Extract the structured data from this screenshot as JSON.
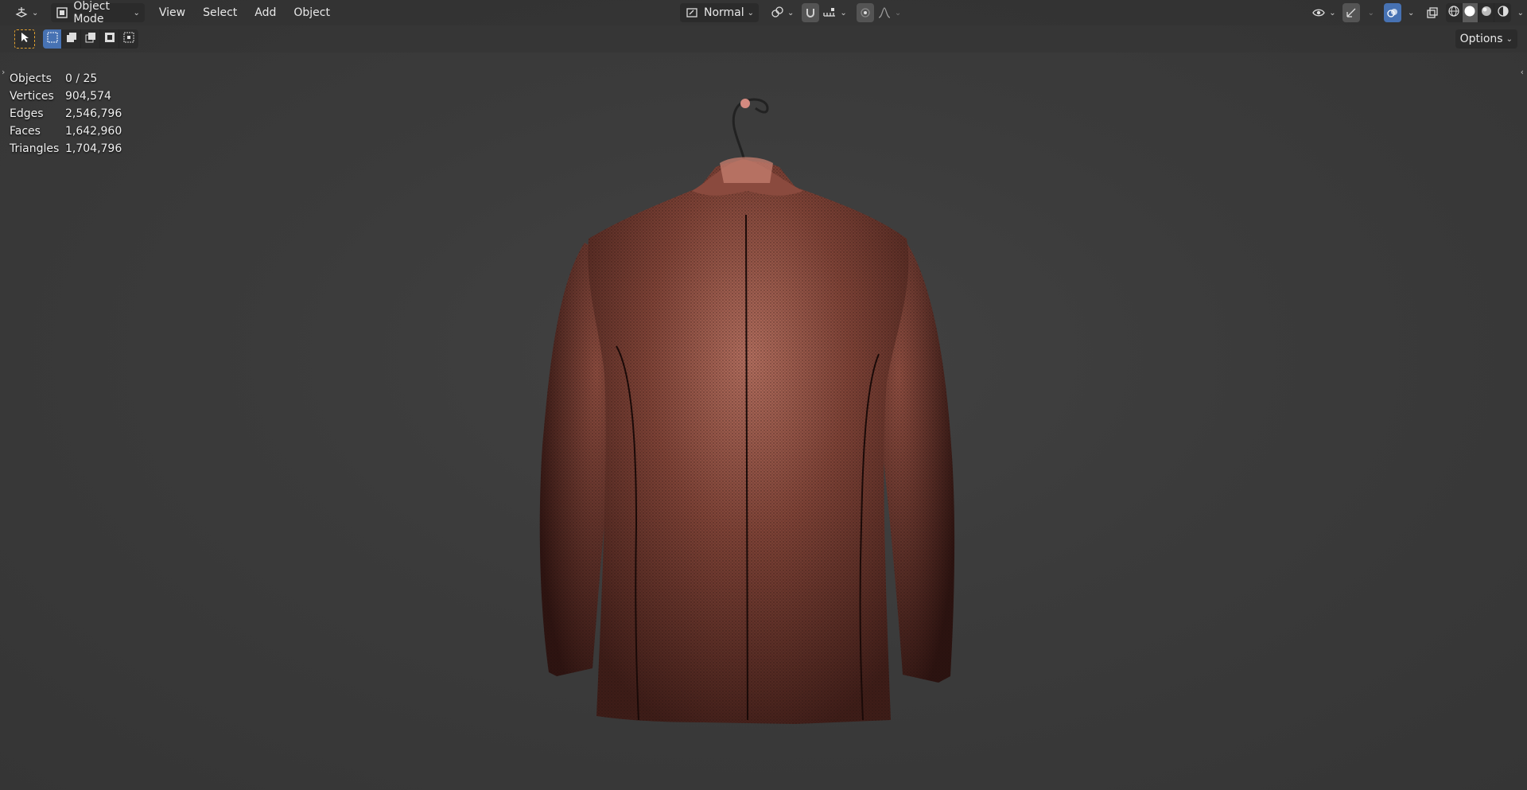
{
  "header": {
    "editor_type_icon": "3d-viewport-icon",
    "mode_label": "Object Mode",
    "menus": [
      "View",
      "Select",
      "Add",
      "Object"
    ],
    "orientation_label": "Normal",
    "options_label": "Options"
  },
  "stats": [
    {
      "label": "Objects",
      "value": "0 / 25"
    },
    {
      "label": "Vertices",
      "value": "904,574"
    },
    {
      "label": "Edges",
      "value": "2,546,796"
    },
    {
      "label": "Faces",
      "value": "1,642,960"
    },
    {
      "label": "Triangles",
      "value": "1,704,796"
    }
  ],
  "colors": {
    "background": "#3a3a3a",
    "accent": "#4772b3",
    "active_tool": "#e0a030",
    "mesh_tint": "#a0584a"
  }
}
